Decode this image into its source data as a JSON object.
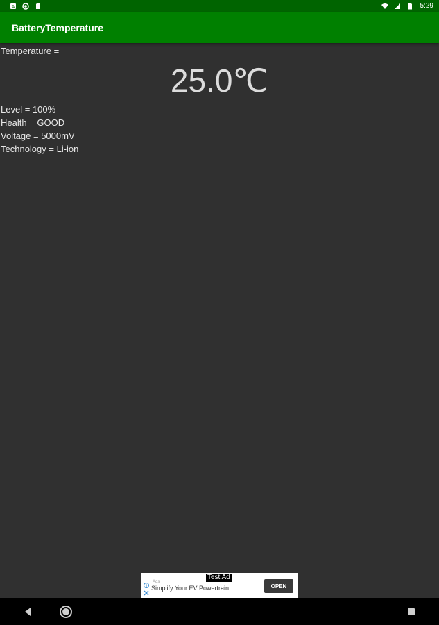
{
  "status_bar": {
    "time": "5:29",
    "icons": [
      "notification-a-icon",
      "circle-notification-icon",
      "sim-card-icon",
      "wifi-icon",
      "signal-icon",
      "battery-icon"
    ]
  },
  "app_bar": {
    "title": "BatteryTemperature",
    "color": "#008000"
  },
  "battery": {
    "temperature_label": "Temperature =",
    "temperature_value": "25.0℃",
    "level": "Level = 100%",
    "health": "Health = GOOD",
    "voltage": "Voltage = 5000mV",
    "technology": "Technology = Li-ion"
  },
  "ad": {
    "tag": "Test Ad",
    "advertiser": "Ads",
    "text": "Simplify Your EV Powertrain",
    "button_label": "OPEN"
  },
  "nav": {
    "icons": [
      "back-icon",
      "home-icon",
      "recents-icon"
    ]
  }
}
